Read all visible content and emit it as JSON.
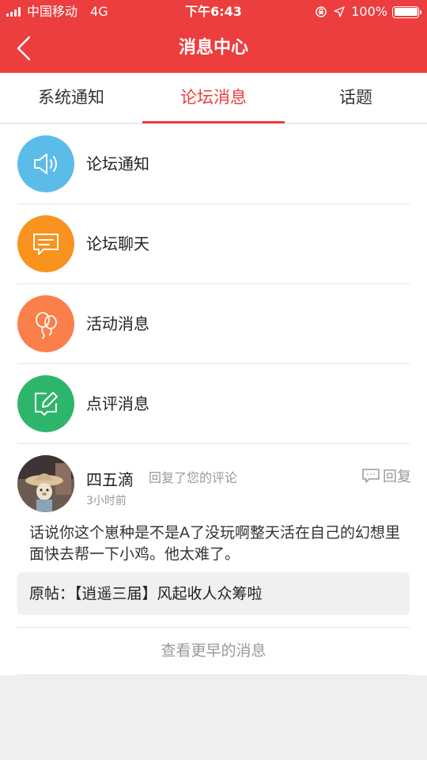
{
  "status_bar": {
    "carrier": "中国移动",
    "network": "4G",
    "time": "下午6:43",
    "battery": "100%"
  },
  "navbar": {
    "title": "消息中心",
    "back_icon": "chevron-left-icon"
  },
  "tabs": [
    {
      "label": "系统通知",
      "active": false
    },
    {
      "label": "论坛消息",
      "active": true
    },
    {
      "label": "话题",
      "active": false
    }
  ],
  "categories": [
    {
      "label": "论坛通知",
      "icon": "speaker-icon",
      "color": "#5bbcea"
    },
    {
      "label": "论坛聊天",
      "icon": "chat-bubble-icon",
      "color": "#f7931e"
    },
    {
      "label": "活动消息",
      "icon": "balloon-icon",
      "color": "#fb7f4b"
    },
    {
      "label": "点评消息",
      "icon": "edit-icon",
      "color": "#2eb56c"
    }
  ],
  "message": {
    "user": "四五滴",
    "action": "回复了您的评论",
    "time": "3小时前",
    "reply_label": "回复",
    "body": "话说你这个崽种是不是A了没玩啊整天活在自己的幻想里面快去帮一下小鸡。他太难了。",
    "quote": "原帖：【逍遥三届】风起收人众筹啦"
  },
  "more_label": "查看更早的消息",
  "colors": {
    "accent": "#ec3e3e",
    "muted_text": "#999999"
  }
}
